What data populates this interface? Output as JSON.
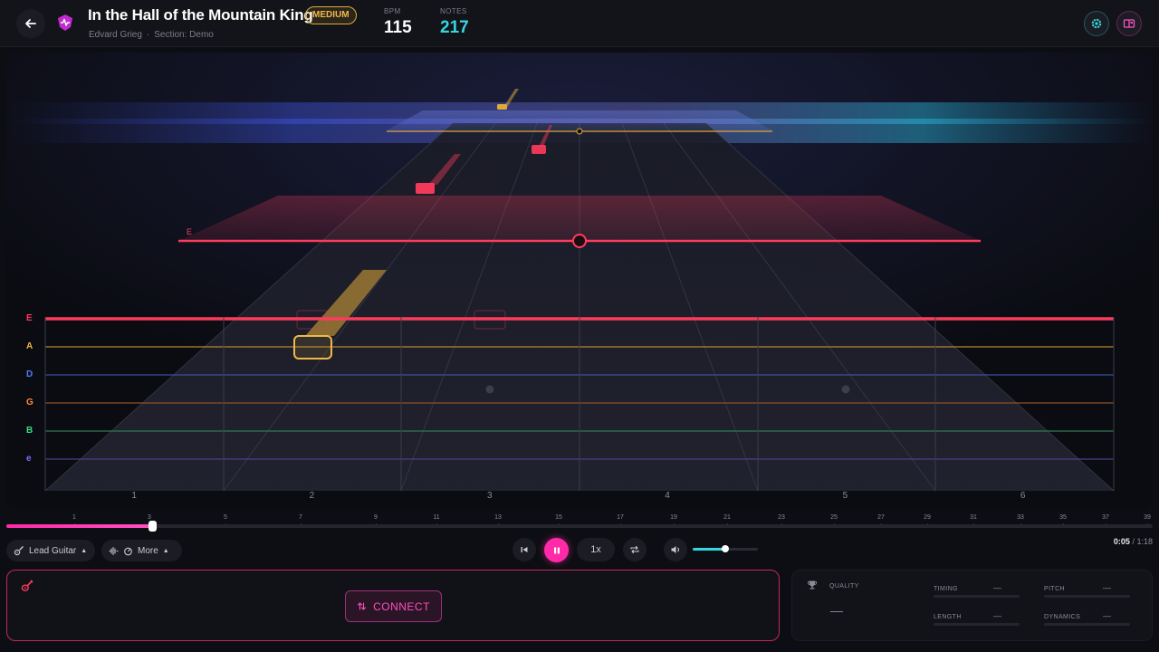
{
  "header": {
    "title": "In the Hall of the Mountain King",
    "difficulty": "MEDIUM",
    "artist": "Edvard Grieg",
    "section": "Section: Demo",
    "bpm_label": "BPM",
    "bpm_value": "115",
    "notes_label": "NOTES",
    "notes_value": "217"
  },
  "highway": {
    "far_string_label": "E",
    "strings": [
      {
        "label": "E",
        "color": "#ff3b5c"
      },
      {
        "label": "A",
        "color": "#f0b84a"
      },
      {
        "label": "D",
        "color": "#4f7cff"
      },
      {
        "label": "G",
        "color": "#ff8a3a"
      },
      {
        "label": "B",
        "color": "#3ddc84"
      },
      {
        "label": "e",
        "color": "#8a6cff"
      }
    ],
    "frets": [
      "1",
      "2",
      "3",
      "4",
      "5",
      "6"
    ]
  },
  "timeline": {
    "ticks": [
      "1",
      "3",
      "5",
      "7",
      "9",
      "11",
      "13",
      "15",
      "17",
      "19",
      "21",
      "23",
      "25",
      "27",
      "29",
      "31",
      "33",
      "35",
      "37",
      "39"
    ],
    "progress": 0.127,
    "current_time": "0:05",
    "separator": "/",
    "total_time": "1:18"
  },
  "controls": {
    "instrument": "Lead Guitar",
    "more": "More",
    "speed": "1x",
    "volume": 0.5
  },
  "connect": {
    "label": "CONNECT"
  },
  "quality": {
    "title": "QUALITY",
    "score": "—",
    "metrics": [
      {
        "label": "TIMING",
        "value": "—"
      },
      {
        "label": "PITCH",
        "value": "—"
      },
      {
        "label": "LENGTH",
        "value": "—"
      },
      {
        "label": "DYNAMICS",
        "value": "—"
      }
    ]
  },
  "colors": {
    "accent": "#ff2aa8",
    "cyan": "#35d6e0",
    "difficulty": "#f0b84a"
  }
}
